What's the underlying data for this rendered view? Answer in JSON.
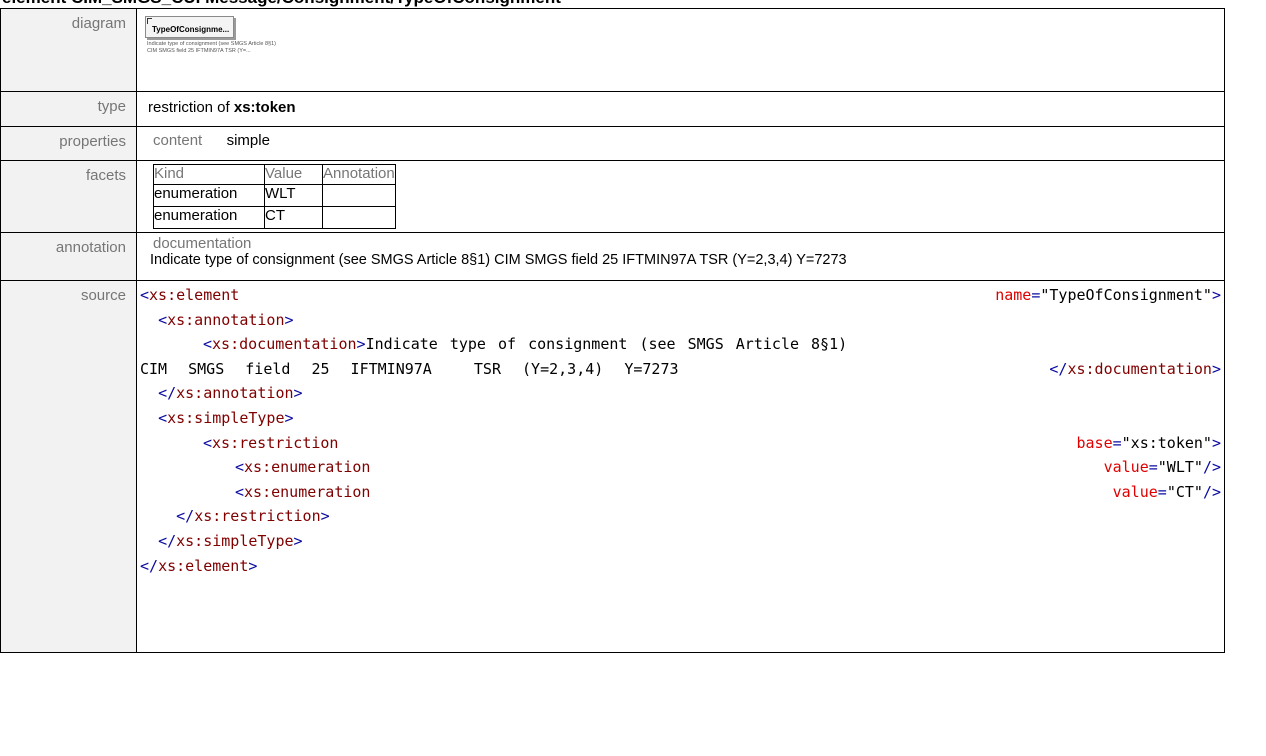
{
  "heading": "element CIM_SMGS_CUI Message/Consignment/TypeOfConsignment",
  "rows": {
    "diagram": {
      "label": "diagram",
      "box_name": "TypeOfConsignme...",
      "box_doc": "Indicate type of consignment (see SMGS Article 8§1) CIM SMGS field 25 IFTMIN97A  TSR (Y=..."
    },
    "type": {
      "label": "type",
      "prefix": "restriction of ",
      "base": "xs:token"
    },
    "properties": {
      "label": "properties",
      "key": "content",
      "value": "simple"
    },
    "facets": {
      "label": "facets",
      "headers": [
        "Kind",
        "Value",
        "Annotation"
      ],
      "items": [
        {
          "kind": "enumeration",
          "value": "WLT"
        },
        {
          "kind": "enumeration",
          "value": "CT"
        }
      ]
    },
    "annotation": {
      "label": "annotation",
      "heading": "documentation",
      "text": "Indicate type of consignment (see SMGS Article 8§1) CIM SMGS field 25 IFTMIN97A  TSR (Y=2,3,4) Y=7273"
    },
    "source": {
      "label": "source",
      "element_open": "xs:element",
      "name_attr": "name",
      "name_val": "\"TypeOfConsignment\"",
      "annotation_tag": "xs:annotation",
      "doc_tag": "xs:documentation",
      "doc_text_1": "Indicate type of consignment (see SMGS Article 8§1)",
      "doc_text_2": "CIM SMGS field 25 IFTMIN97A  TSR (Y=2,3,4) Y=7273",
      "simpletype_tag": "xs:simpleType",
      "restriction_tag": "xs:restriction",
      "base_attr": "base",
      "base_val": "\"xs:token\"",
      "enum_tag": "xs:enumeration",
      "value_attr": "value",
      "enum_val_1": "\"WLT\"",
      "enum_val_2": "\"CT\""
    }
  }
}
